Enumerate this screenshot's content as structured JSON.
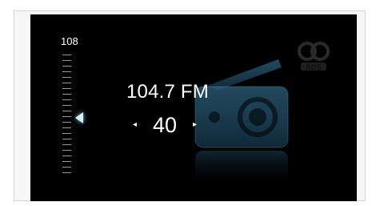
{
  "tuner": {
    "scale_max_label": "108",
    "station_label": "104.7 FM",
    "preset_number": "40",
    "preset_prev_symbol": "◂",
    "preset_next_symbol": "▸"
  },
  "icons": {
    "radio": "radio-icon",
    "rds": "rds-logo-icon",
    "pointer": "frequency-pointer-icon"
  },
  "colors": {
    "screen_bg": "#000000",
    "text": "#ffffff",
    "radio_glow": "#2b5f7a",
    "pointer": "#d7f0ff"
  }
}
